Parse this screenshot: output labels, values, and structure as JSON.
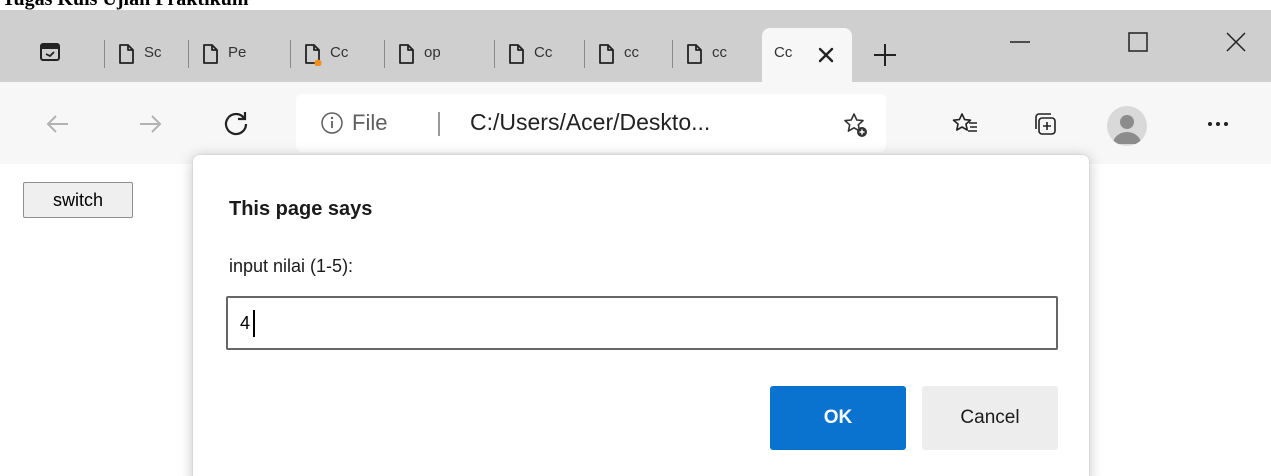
{
  "document": {
    "heading": "Tugas Kuis Ujian Praktikum"
  },
  "tabs": [
    {
      "label": "Sc"
    },
    {
      "label": "Pe"
    },
    {
      "label": "Cc"
    },
    {
      "label": "op"
    },
    {
      "label": "Cc"
    },
    {
      "label": "cc"
    },
    {
      "label": "cc"
    },
    {
      "label": "Cc",
      "active": true
    }
  ],
  "toolbar": {
    "scheme_label": "File",
    "url": "C:/Users/Acer/Deskto..."
  },
  "page": {
    "switch_label": "switch"
  },
  "dialog": {
    "title": "This page says",
    "message": "input nilai (1-5):",
    "input_value": "4",
    "ok_label": "OK",
    "cancel_label": "Cancel"
  },
  "colors": {
    "accent": "#0a72cf",
    "tabbar": "#cfcfcf",
    "toolbar": "#f7f7f7",
    "notification_dot": "#f28c1b"
  }
}
